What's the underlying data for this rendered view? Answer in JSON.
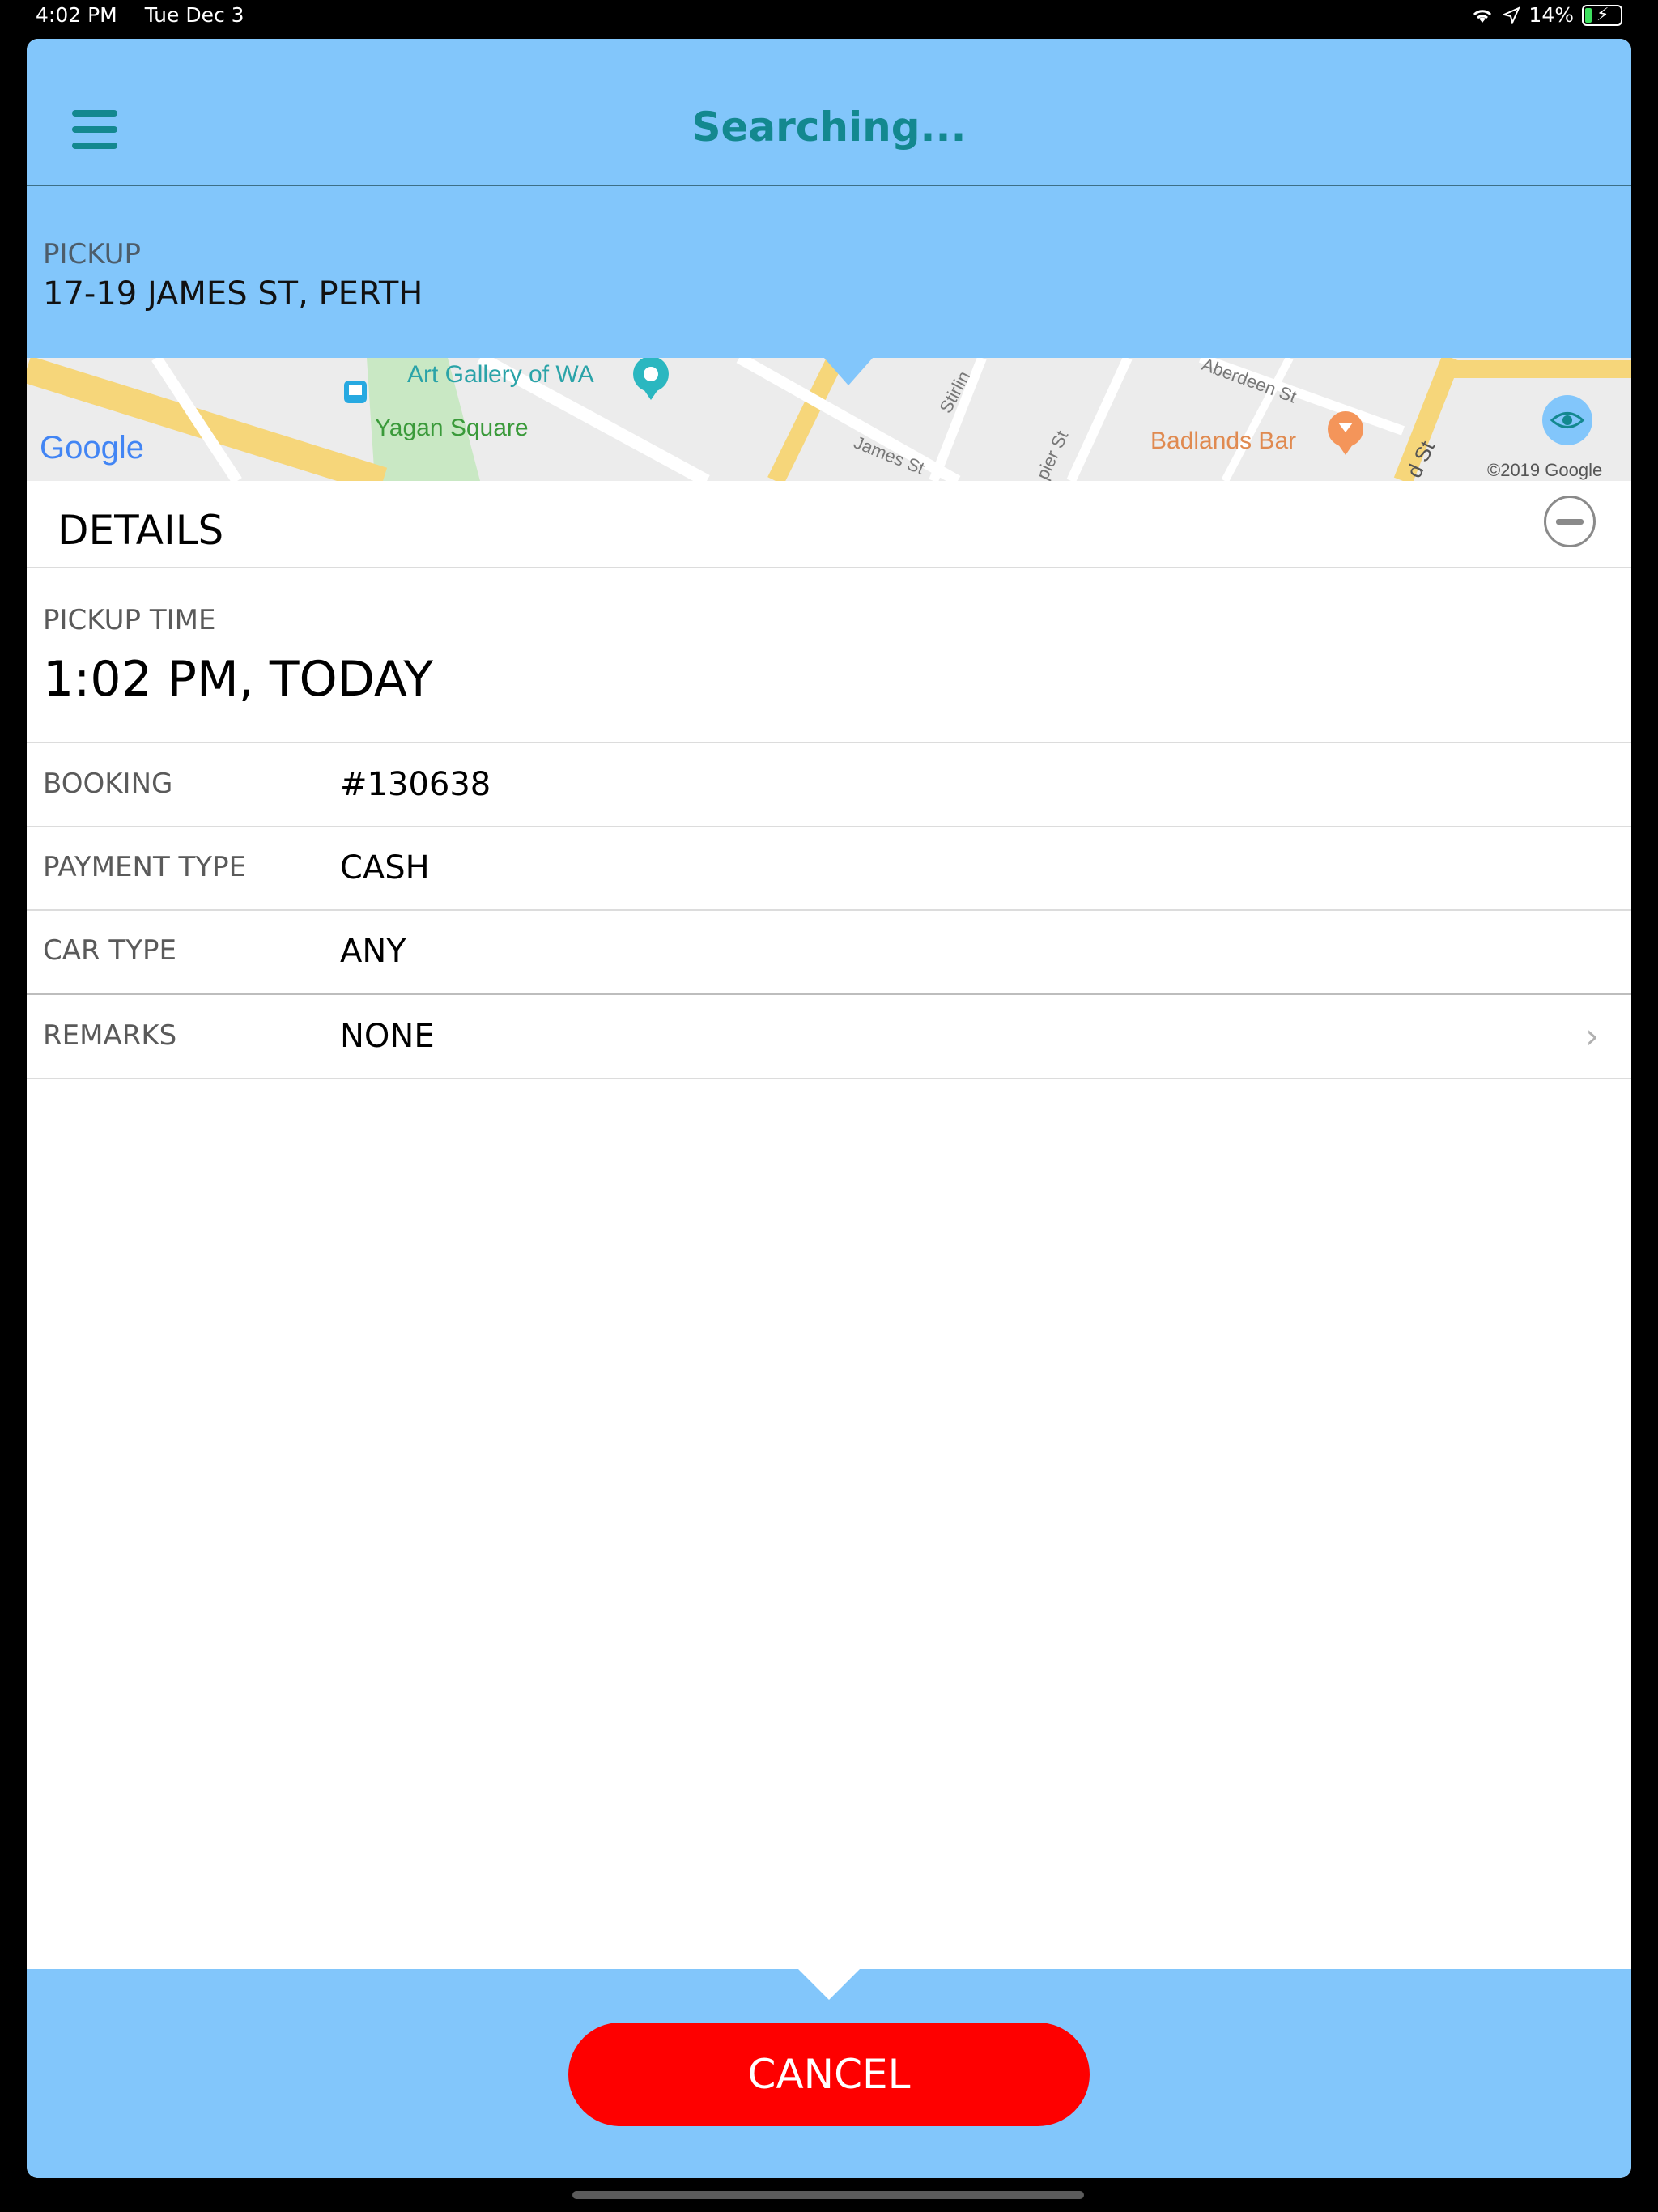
{
  "status_bar": {
    "time": "4:02 PM",
    "date": "Tue Dec 3",
    "battery": "14%",
    "icons": [
      "wifi-icon",
      "location-arrow-icon",
      "battery-charging-icon"
    ]
  },
  "header": {
    "title": "Searching...",
    "menu_icon": "hamburger-menu-icon"
  },
  "pickup": {
    "label": "PICKUP",
    "address": "17-19 JAMES ST, PERTH"
  },
  "map": {
    "places": [
      "Art Gallery of WA",
      "Yagan Square",
      "Badlands Bar"
    ],
    "streets": [
      "James St",
      "Stirlin",
      "Aberdeen St",
      "pier St",
      "d St"
    ],
    "brand": "Google",
    "copyright": "©2019 Google",
    "icons": [
      "palette-pin-icon",
      "bus-stop-icon",
      "cocktail-pin-icon",
      "eye-icon"
    ]
  },
  "details": {
    "title": "DETAILS",
    "collapse_icon": "minus-circle-icon",
    "pickup_time_label": "PICKUP TIME",
    "pickup_time_value": "1:02 PM, TODAY",
    "rows": [
      {
        "label": "BOOKING",
        "value": "#130638"
      },
      {
        "label": "PAYMENT TYPE",
        "value": "CASH"
      },
      {
        "label": "CAR TYPE",
        "value": "ANY"
      },
      {
        "label": "REMARKS",
        "value": "NONE",
        "chevron": "›"
      }
    ]
  },
  "footer": {
    "cancel_label": "CANCEL"
  },
  "colors": {
    "header_bg": "#82c6fb",
    "accent": "#13888f",
    "cancel": "#fe0000"
  }
}
